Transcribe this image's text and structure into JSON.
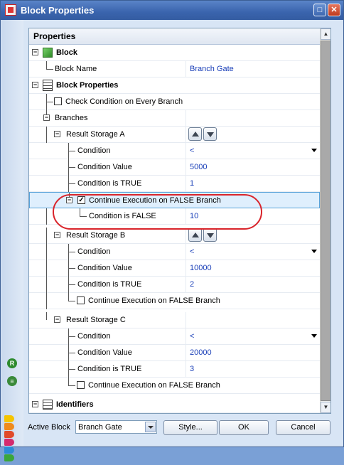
{
  "window": {
    "title": "Block Properties"
  },
  "sidebar": {
    "icons": [
      "r-icon",
      "list-icon"
    ]
  },
  "grid": {
    "header": "Properties",
    "block_section": "Block",
    "block_name": {
      "label": "Block Name",
      "value": "Branch Gate"
    },
    "block_props_section": "Block Properties",
    "check_condition_label": "Check Condition on Every Branch",
    "branches_label": "Branches",
    "storage_a": {
      "label": "Result Storage A",
      "condition": {
        "label": "Condition",
        "value": "<"
      },
      "condition_value": {
        "label": "Condition Value",
        "value": "5000"
      },
      "condition_true": {
        "label": "Condition is TRUE",
        "value": "1"
      },
      "continue_label": "Continue Execution on FALSE Branch",
      "continue_checked": true,
      "condition_false": {
        "label": "Condition is FALSE",
        "value": "10"
      }
    },
    "storage_b": {
      "label": "Result Storage B",
      "condition": {
        "label": "Condition",
        "value": "<"
      },
      "condition_value": {
        "label": "Condition Value",
        "value": "10000"
      },
      "condition_true": {
        "label": "Condition is TRUE",
        "value": "2"
      },
      "continue_label": "Continue Execution on FALSE Branch",
      "continue_checked": false
    },
    "storage_c": {
      "label": "Result Storage C",
      "condition": {
        "label": "Condition",
        "value": "<"
      },
      "condition_value": {
        "label": "Condition Value",
        "value": "20000"
      },
      "condition_true": {
        "label": "Condition is TRUE",
        "value": "3"
      },
      "continue_label": "Continue Execution on FALSE Branch",
      "continue_checked": false
    },
    "identifiers_section": "Identifiers"
  },
  "footer": {
    "active_block_label": "Active Block",
    "active_block_value": "Branch Gate",
    "style_button": "Style...",
    "ok_button": "OK",
    "cancel_button": "Cancel"
  },
  "colors": {
    "highlight": "#d9242b",
    "value_text": "#1a3fb8",
    "title_bar": "#3a64ad"
  }
}
